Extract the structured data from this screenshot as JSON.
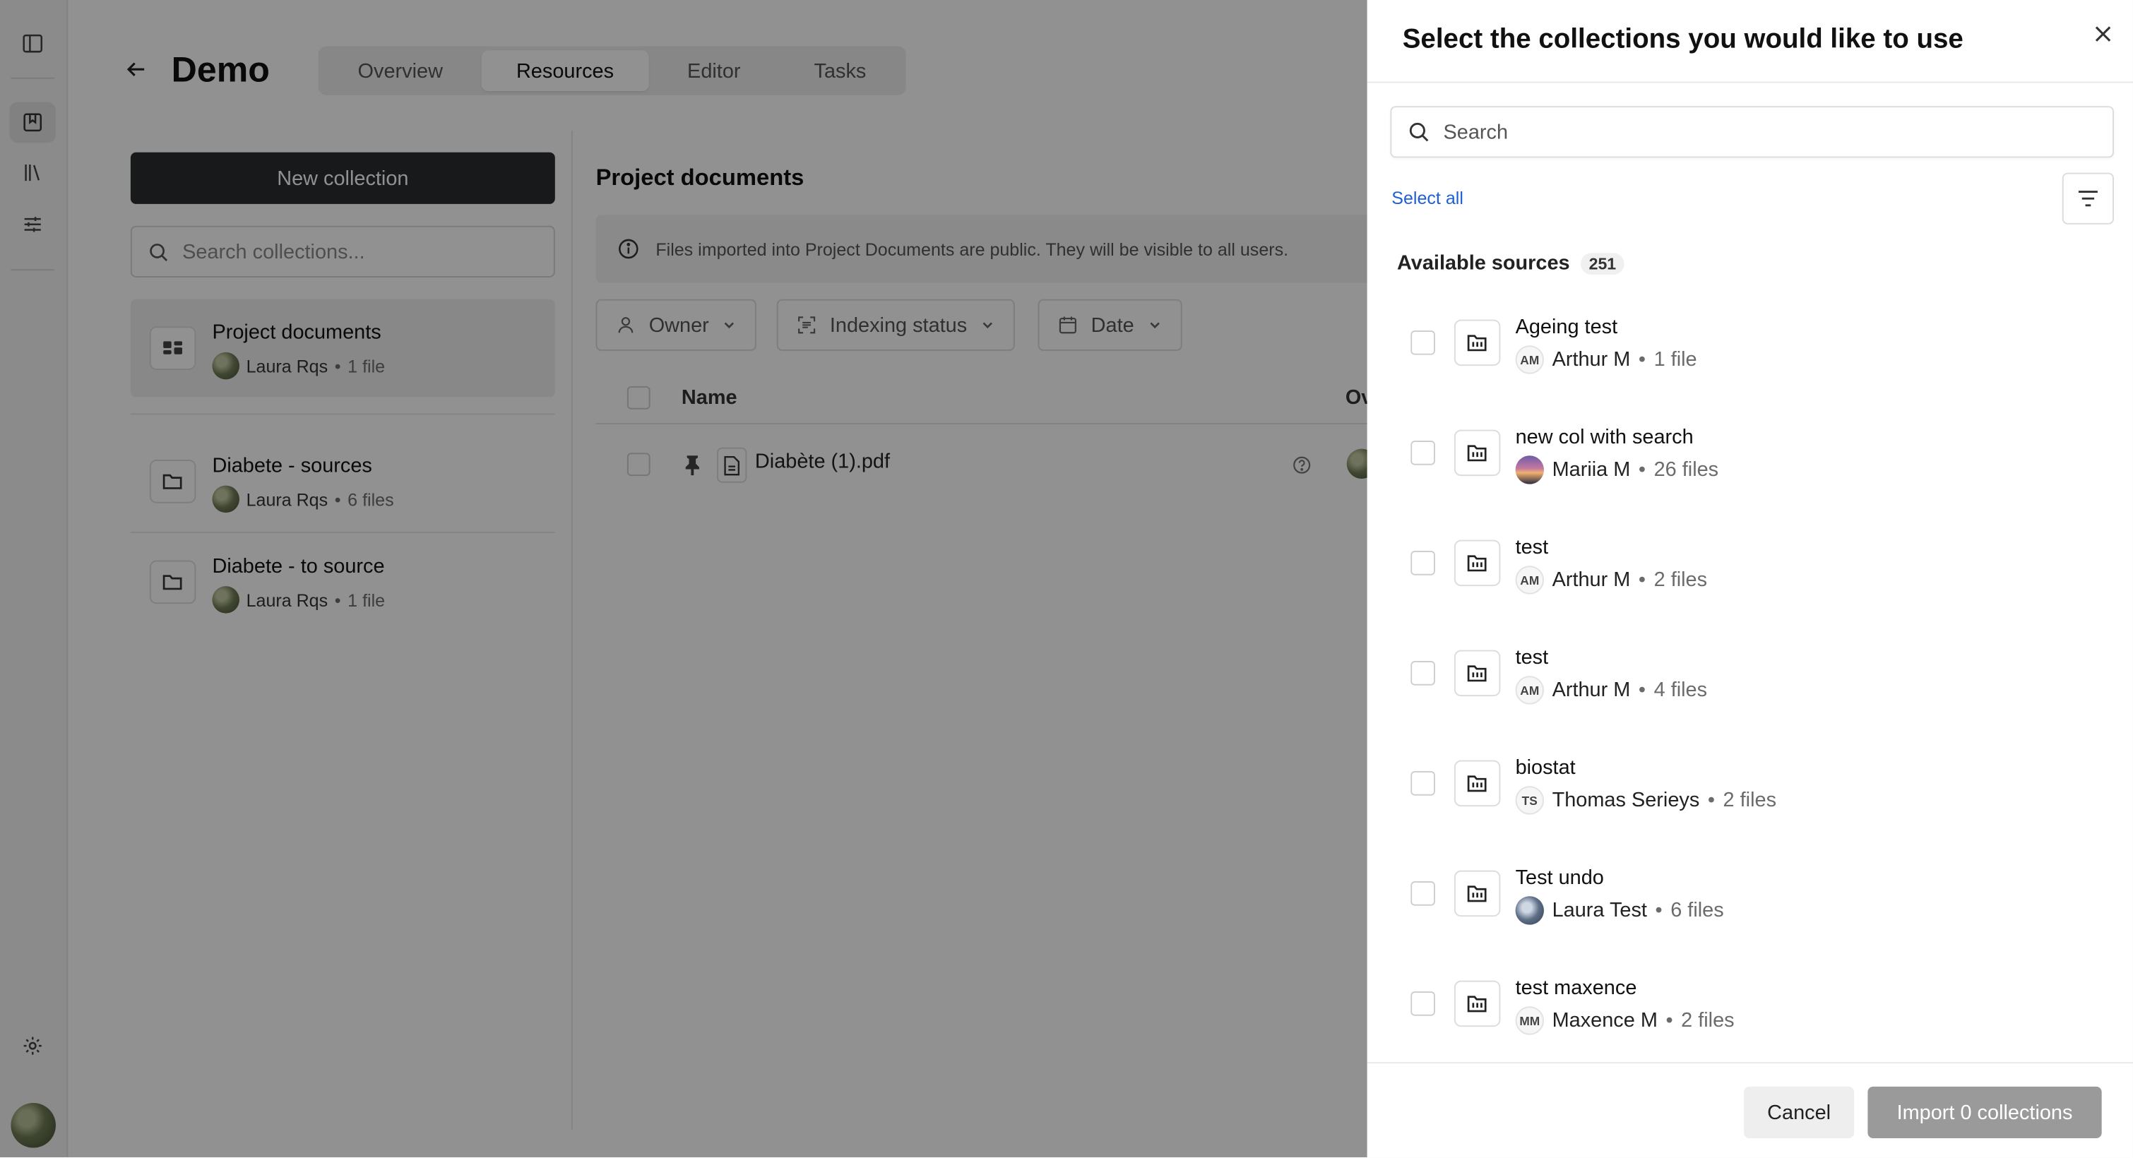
{
  "app": {
    "title": "Demo",
    "tabs": [
      {
        "label": "Overview"
      },
      {
        "label": "Resources"
      },
      {
        "label": "Editor"
      },
      {
        "label": "Tasks"
      }
    ],
    "new_collection_label": "New collection",
    "search_collections_placeholder": "Search collections...",
    "collections": [
      {
        "name": "Project documents",
        "owner": "Laura Rqs",
        "count": "1 file"
      },
      {
        "name": "Diabete - sources",
        "owner": "Laura Rqs",
        "count": "6 files"
      },
      {
        "name": "Diabete - to source",
        "owner": "Laura Rqs",
        "count": "1 file"
      }
    ],
    "panel_title": "Project documents",
    "info_text": "Files imported into Project Documents are public. They will be visible to all users.",
    "filters": [
      {
        "label": "Owner"
      },
      {
        "label": "Indexing status"
      },
      {
        "label": "Date"
      }
    ],
    "table": {
      "col_name": "Name",
      "col_owner": "Ov",
      "rows": [
        {
          "name": "Diabète (1).pdf"
        }
      ]
    }
  },
  "drawer": {
    "title": "Select the collections you would like to use",
    "search_placeholder": "Search",
    "select_all_label": "Select all",
    "available_label": "Available sources",
    "available_count": "251",
    "sources": [
      {
        "name": "Ageing test",
        "avatar": "AM",
        "owner": "Arthur M",
        "count": "1 file"
      },
      {
        "name": "new col with search",
        "avatar": "",
        "owner": "Mariia M",
        "count": "26 files"
      },
      {
        "name": "test",
        "avatar": "AM",
        "owner": "Arthur M",
        "count": "2 files"
      },
      {
        "name": "test",
        "avatar": "AM",
        "owner": "Arthur M",
        "count": "4 files"
      },
      {
        "name": "biostat",
        "avatar": "TS",
        "owner": "Thomas Serieys",
        "count": "2 files"
      },
      {
        "name": "Test undo",
        "avatar": "",
        "owner": "Laura Test",
        "count": "6 files"
      },
      {
        "name": "test maxence",
        "avatar": "MM",
        "owner": "Maxence M",
        "count": "2 files"
      }
    ],
    "cancel_label": "Cancel",
    "import_label": "Import 0 collections"
  },
  "colors": {
    "overlay": "#00000070",
    "primary_dark": "#2a2d31",
    "link": "#1f5fd6",
    "import_disabled": "#9a9a9a"
  },
  "icons": [
    "sidebar-toggle-icon",
    "bookmark-icon",
    "library-icon",
    "sliders-icon",
    "gear-icon",
    "arrow-left-icon",
    "search-icon",
    "folder-icon",
    "info-icon",
    "person-icon",
    "scan-icon",
    "calendar-icon",
    "chevron-down-icon",
    "pin-icon",
    "document-icon",
    "help-circle-icon",
    "close-icon",
    "filter-lines-icon",
    "collection-folder-icon"
  ]
}
